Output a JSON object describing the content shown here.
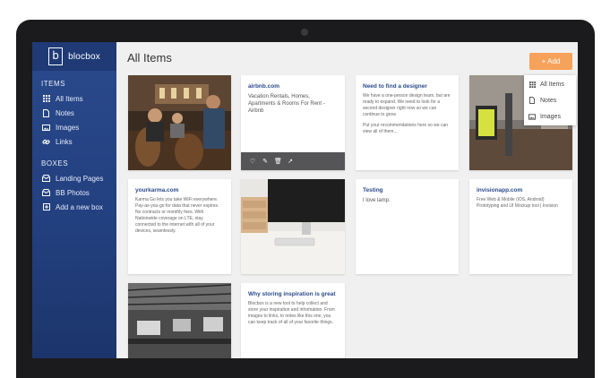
{
  "app": {
    "name": "blocbox",
    "logo_letter": "b"
  },
  "sidebar": {
    "items_heading": "ITEMS",
    "items": [
      {
        "label": "All Items",
        "icon": "grid-icon"
      },
      {
        "label": "Notes",
        "icon": "note-icon"
      },
      {
        "label": "Images",
        "icon": "image-icon"
      },
      {
        "label": "Links",
        "icon": "link-icon"
      }
    ],
    "boxes_heading": "BOXES",
    "boxes": [
      {
        "label": "Landing Pages",
        "icon": "box-icon"
      },
      {
        "label": "BB Photos",
        "icon": "box-icon"
      },
      {
        "label": "Add a new box",
        "icon": "plus-box-icon"
      }
    ]
  },
  "main": {
    "title": "All Items",
    "add_label": "+ Add",
    "dropdown": [
      {
        "label": "All Items",
        "icon": "grid-icon"
      },
      {
        "label": "Notes",
        "icon": "note-icon"
      },
      {
        "label": "Images",
        "icon": "image-icon"
      }
    ]
  },
  "cards": {
    "airbnb": {
      "title": "airbnb.com",
      "text": "Vacation Rentals, Homes, Apartments & Rooms For Rent - Airbnb"
    },
    "designer": {
      "title": "Need to find a designer",
      "p1": "We have a one-person design team, but are ready to expand. We need to look for a second designer right now so we can continue to grow.",
      "p2": "Put your recommendations here so we can view all of them..."
    },
    "yourkarma": {
      "title": "yourkarma.com",
      "p1": "Karma Go lets you take WiFi everywhere. Pay-as-you-go for data that never expires. No contracts or monthly fees. With Nationwide coverage on LTE, stay connected to the internet with all of your devices, seamlessly."
    },
    "testing": {
      "title": "Testing",
      "text": "I love lamp."
    },
    "invision": {
      "title": "invisionapp.com",
      "p1": "Free Web & Mobile (iOS, Android) Prototyping and UI Mockup tool | Invision"
    },
    "inspiration": {
      "title": "Why storing inspiration is great",
      "text": "Blocbox is a new tool to help collect and store your inspiration and information. From images to links, to notes like this one, you can keep track of all of your favorite things."
    }
  },
  "colors": {
    "sidebar": "#2a4a8c",
    "accent": "#f7a25a",
    "link": "#2a4a8c"
  }
}
